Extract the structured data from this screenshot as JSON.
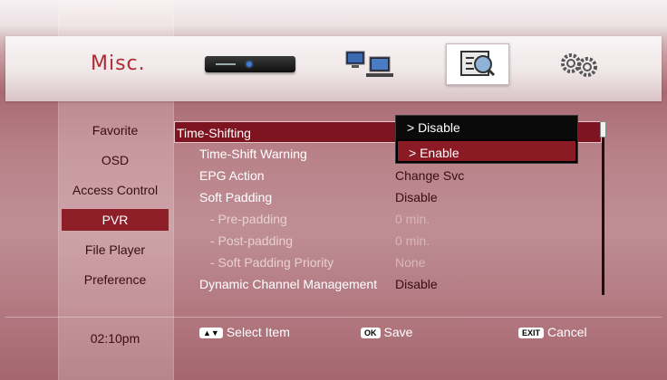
{
  "header": {
    "title": "Misc.",
    "icons": [
      "set-top-box-icon",
      "network-icon",
      "misc-settings-icon",
      "gears-icon"
    ],
    "selected_icon": "misc-settings-icon"
  },
  "sidebar": {
    "items": [
      {
        "label": "Favorite"
      },
      {
        "label": "OSD"
      },
      {
        "label": "Access Control"
      },
      {
        "label": "PVR"
      },
      {
        "label": "File Player"
      },
      {
        "label": "Preference"
      }
    ],
    "selected": "PVR",
    "time": "02:10pm"
  },
  "menu": {
    "rows": [
      {
        "label": "Time-Shifting",
        "value": ""
      },
      {
        "label": "Time-Shift Warning",
        "value": ""
      },
      {
        "label": "EPG Action",
        "value": "Change Svc"
      },
      {
        "label": "Soft Padding",
        "value": "Disable"
      },
      {
        "label": "- Pre-padding",
        "value": "0 min."
      },
      {
        "label": "- Post-padding",
        "value": "0 min."
      },
      {
        "label": "- Soft Padding Priority",
        "value": "None"
      },
      {
        "label": "Dynamic Channel Management",
        "value": "Disable"
      }
    ],
    "highlighted": "Time-Shifting"
  },
  "dropdown": {
    "options": [
      "> Disable",
      "> Enable"
    ],
    "selected": "> Enable"
  },
  "footer": {
    "select_key": "▲▼",
    "select_label": "Select Item",
    "ok_key": "OK",
    "ok_label": "Save",
    "exit_key": "EXIT",
    "exit_label": "Cancel"
  },
  "colors": {
    "accent": "#8e1f28",
    "title": "#b02a33",
    "dropdown_bg": "#0a0a0a"
  }
}
